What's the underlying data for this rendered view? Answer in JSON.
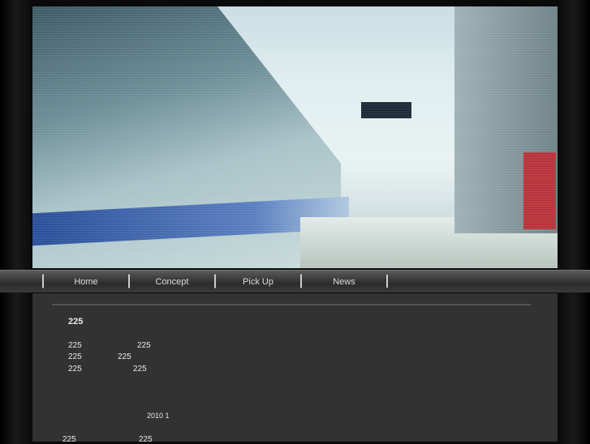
{
  "nav": {
    "items": [
      "Home",
      "Concept",
      "Pick Up",
      "News"
    ]
  },
  "content": {
    "heading": "225",
    "rows": [
      [
        "225",
        "225"
      ],
      [
        "225",
        "225"
      ],
      [
        "225",
        "225"
      ]
    ],
    "date": "2010 1",
    "footer_row": [
      "225",
      "225"
    ]
  }
}
